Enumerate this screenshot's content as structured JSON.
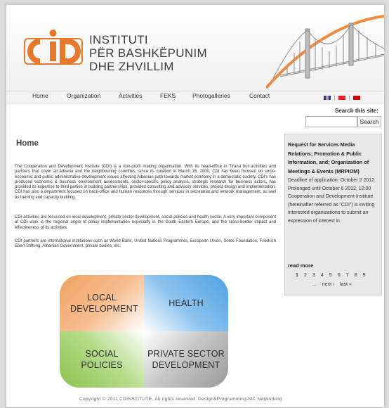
{
  "header": {
    "title_lines": [
      "INSTITUTI",
      "PËR BASHKËPUNIM",
      "DHE ZHVILLIM"
    ]
  },
  "nav": {
    "items": [
      "Home",
      "Organization",
      "Activities",
      "FEKS",
      "Photogalleries",
      "Contact"
    ]
  },
  "languages": {
    "separator": "|"
  },
  "search": {
    "label": "Search this site:",
    "value": "",
    "button": "Search"
  },
  "main": {
    "title": "Home",
    "paragraphs": [
      "The Cooperation and Development Institute (CDI) is a non-profit making organisation. With its head-office in Tirana but activities and partners that cover all Albania and the neighbouring countries, since its creation in March 15, 2000, CDI has been focused on socio-economic and public administrative development issues affecting Albanian path towards market economy in a democratic society. CDI's has produced economic & business environment assessments, sector-specific policy analysis, strategic research for business actors, has provided its expertise to third parties in building partnerships, provided consulting and advisory services, project design and implementation. CDI has also a department focused on back-office and human resources through services in secretariat and network management, as well as training and capacity building.",
      "CDI activities are focussed on local development, private sector development, social policies and health sector. A very important component of CDI work is the regional angle of policy implementation especially in the South Eastern Europe, and the cross-border impact and effectiveness of its activities.",
      "CDI partners are international institutions such as World Bank, United Nations Programmes, European Union, Soros Foundation, Friedrich Ebert Stiftung, Albanian Government, private bodies, etc."
    ],
    "quadrants": {
      "local": "LOCAL DEVELOPMENT",
      "health": "HEALTH",
      "social": "SOCIAL POLICIES",
      "private": "PRIVATE SECTOR DEVELOPMENT"
    }
  },
  "sidebar": {
    "title": "Request for Services Media Relations; Promotion & Public Information, and; Organization of Meetings & Events (MRPIOM)",
    "text": "Deadline of application: October 2 2012. Prolonged until October 6 2012, 12:00 Cooperation and Development Institute (hereinafter referred as “CDI”) is inviting interested organizations to submit an expression of interest in",
    "read_more": "read more",
    "pages": [
      "1",
      "2",
      "3",
      "4",
      "5",
      "6",
      "7",
      "8",
      "9"
    ],
    "current_page": "1",
    "ellipsis": "…",
    "next": "next ›",
    "last": "last »"
  },
  "footer": {
    "text": "Copyright © 2011 CDINSTITUTE. All rights reserved. Design&Programming-MC Networking"
  },
  "colors": {
    "logo_orange": "#e8792b",
    "arc_orange": "#f08a3c",
    "local": "#f1a160",
    "health": "#4ea1e1",
    "social": "#8bc24f",
    "private": "#9a9a9a"
  }
}
